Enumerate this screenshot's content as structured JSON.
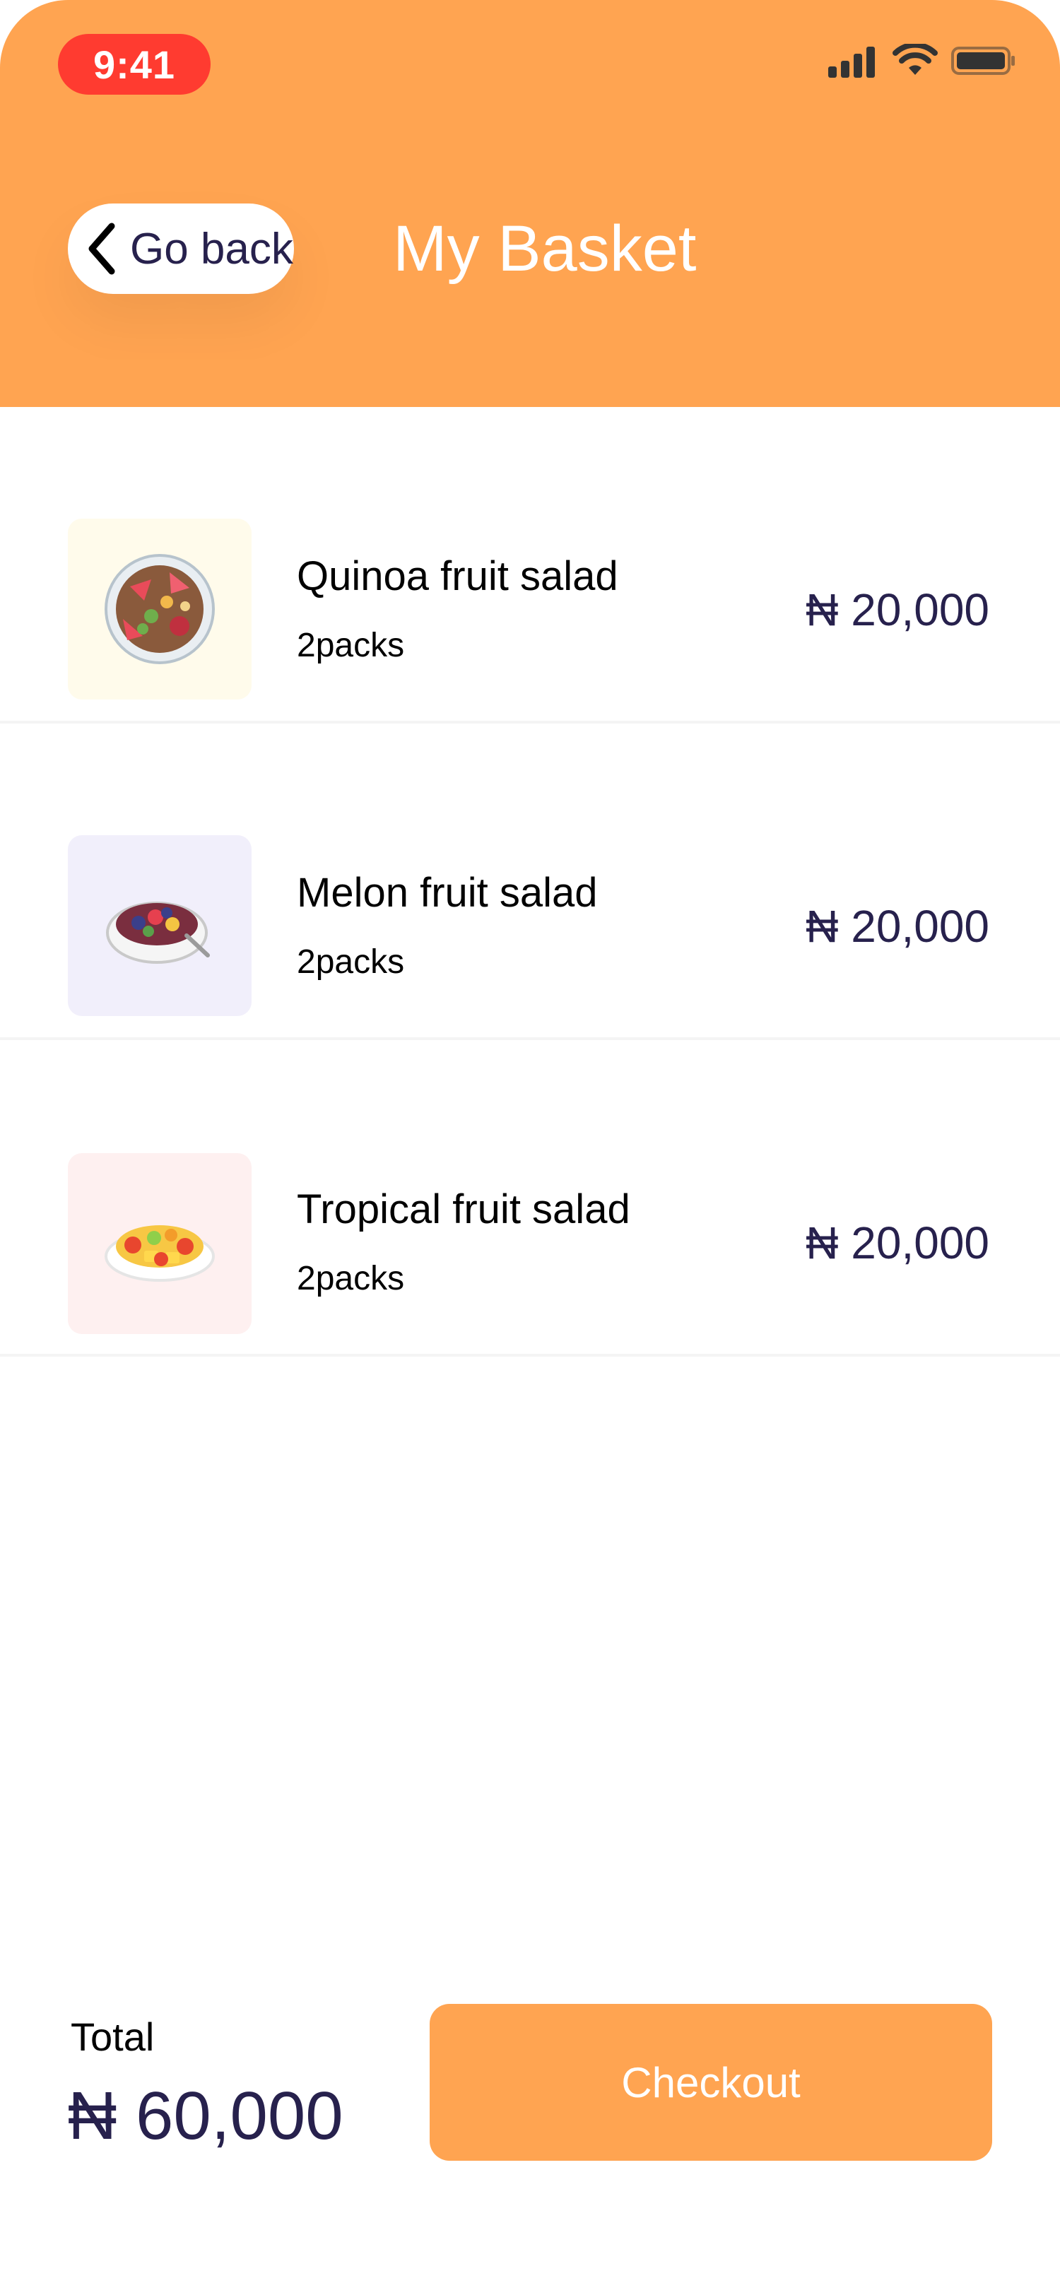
{
  "status_bar": {
    "time": "9:41"
  },
  "header": {
    "back_label": "Go back",
    "title": "My Basket",
    "colors": {
      "accent": "#ffa451",
      "time_pill": "#ff3b30"
    }
  },
  "items": [
    {
      "name": "Quinoa fruit salad",
      "qty": "2packs",
      "price": "₦ 20,000",
      "thumb_bg": "#fffbeb",
      "icon": "quinoa-salad-icon"
    },
    {
      "name": "Melon fruit salad",
      "qty": "2packs",
      "price": "₦ 20,000",
      "thumb_bg": "#f1effb",
      "icon": "melon-salad-icon"
    },
    {
      "name": "Tropical fruit salad",
      "qty": "2packs",
      "price": "₦ 20,000",
      "thumb_bg": "#fef0f0",
      "icon": "tropical-salad-icon"
    }
  ],
  "footer": {
    "total_label": "Total",
    "total_amount": "₦ 60,000",
    "checkout_label": "Checkout"
  }
}
